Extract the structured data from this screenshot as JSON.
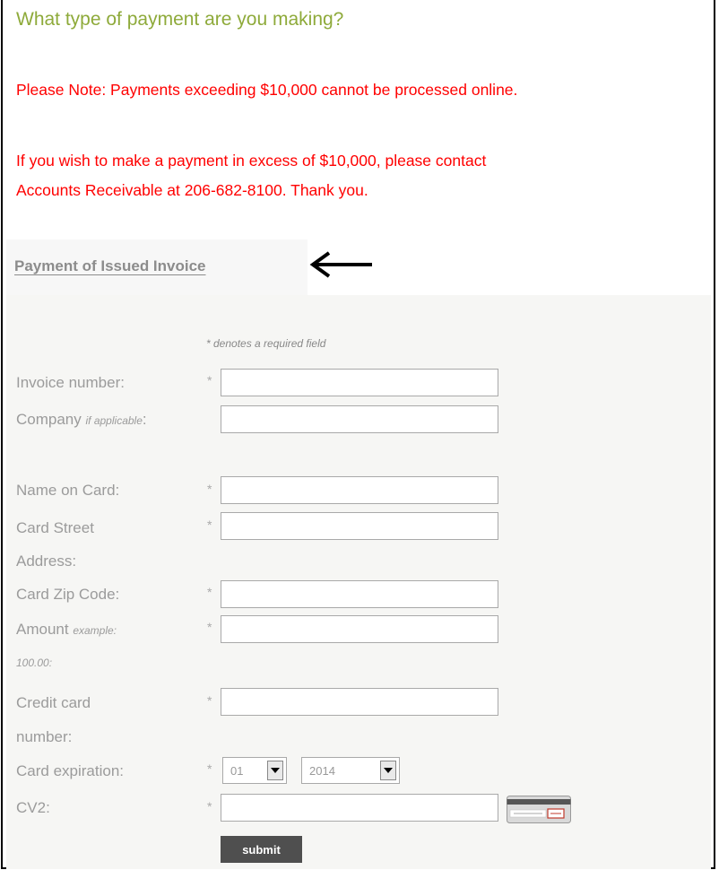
{
  "section_title": "What type of payment are you making?",
  "notes": {
    "limit_note": "Please Note: Payments exceeding $10,000 cannot be processed online.",
    "contact_line1": "If you wish to make a payment in excess of $10,000, please contact",
    "contact_line2": "Accounts Receivable at 206-682-8100. Thank you."
  },
  "payment_tab": {
    "label": "Payment of Issued Invoice",
    "arrow_icon": "left-arrow-icon"
  },
  "form": {
    "required_note": "* denotes a required field",
    "required_marker": "*",
    "fields": {
      "invoice_number": {
        "label": "Invoice number:",
        "value": ""
      },
      "company": {
        "label": "Company",
        "hint": "if applicable",
        "suffix": ":",
        "value": ""
      },
      "name_on_card": {
        "label": "Name on Card:",
        "value": ""
      },
      "card_street_address": {
        "label_line1": "Card Street",
        "label_line2": "Address:",
        "value": ""
      },
      "card_zip_code": {
        "label": "Card Zip Code:",
        "value": ""
      },
      "amount": {
        "label": "Amount",
        "hint_line1": "example:",
        "hint_line2": "100.00",
        "suffix": ":",
        "value": ""
      },
      "credit_card_number": {
        "label_line1": "Credit card",
        "label_line2": "number:",
        "value": ""
      },
      "card_expiration": {
        "label": "Card expiration:",
        "month": "01",
        "year": "2014"
      },
      "cv2": {
        "label": "CV2:",
        "value": "",
        "hint_icon": "card-security-code-icon"
      }
    },
    "submit_label": "submit"
  },
  "colors": {
    "title": "#8eaa3a",
    "warning": "#ff0000",
    "label": "#9b9b9b",
    "submit_bg": "#4f4f4f"
  }
}
